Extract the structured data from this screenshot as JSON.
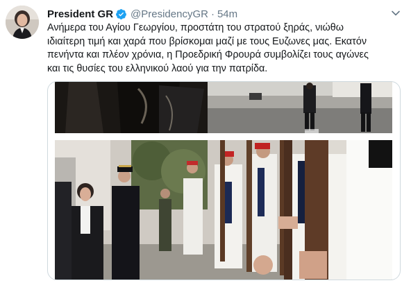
{
  "tweet": {
    "display_name": "President GR",
    "handle": "@PresidencyGR",
    "separator": "·",
    "time": "54m",
    "text_lines": [
      "Ανήμερα του Αγίου Γεωργίου, προστάτη του στρατού ξηράς, νιώθω",
      "ιδιαίτερη τιμή και χαρά που βρίσκομαι μαζί με τους Ευζωνες μας. Εκατόν",
      "πενήντα και πλέον χρόνια, η Προεδρική Φρουρά συμβολίζει τους αγώνες",
      "και τις θυσίες του ελληνικού λαού για την πατρίδα."
    ],
    "verified_icon": "verified-badge-icon",
    "menu_icon": "chevron-down-icon"
  },
  "colors": {
    "verified": "#1da1f2",
    "secondary_text": "#657786",
    "border": "#cfd9de"
  }
}
